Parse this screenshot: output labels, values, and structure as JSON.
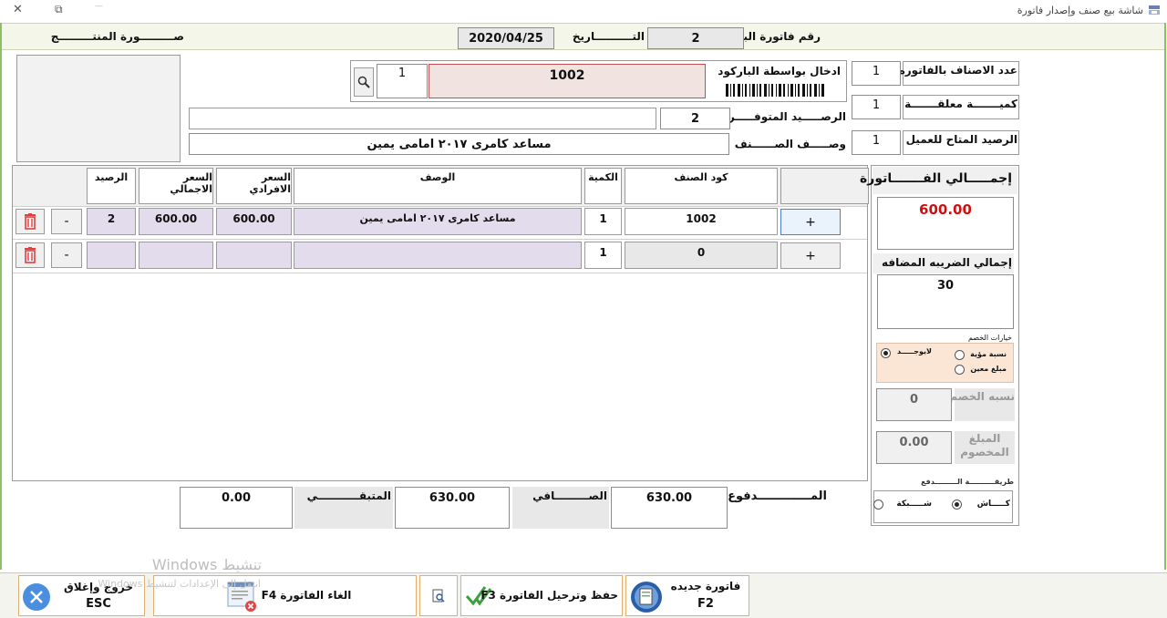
{
  "window": {
    "title": "شاشة بيع صنف وإصدار فاتورة",
    "close_glyph": "✕",
    "restore_glyph": "⧉",
    "minimize_glyph": "—"
  },
  "header": {
    "invoice_number_label": "رقم فاتورة البيع",
    "invoice_number": "2",
    "date_label": "التــــــــــاريخ",
    "date": "2020/04/25",
    "product_image_label": "صـــــــــورة المنتـــــــــج"
  },
  "entry": {
    "barcode_label": "ادخال بواسطة الباركود",
    "barcode_value": "1002",
    "quantity_value": "1",
    "available_balance_label": "الرصـــــيد المتوفـــــر",
    "available_balance": "2",
    "item_description_label": "وصـــــف الصــــــنف",
    "item_description": "مساعد كامرى ٢٠١٧ امامى يمين",
    "items_count_label": "عدد الاصناف بالفاتوره",
    "items_count": "1",
    "pending_qty_label": "كميـــــــة معلقـــــــة",
    "pending_qty": "1",
    "customer_balance_label": "الرصيد المتاح للعميل",
    "customer_balance": "1"
  },
  "grid": {
    "headers": {
      "code": "كود الصنف",
      "qty": "الكمية",
      "desc": "الوصف",
      "unit_price": "السعر الافرادي",
      "total_price": "السعر الاجمالي",
      "balance": "الرصيد"
    },
    "rows": [
      {
        "add": "+",
        "code": "1002",
        "qty": "1",
        "desc": "مساعد كامرى ٢٠١٧ امامى يمين",
        "unit_price": "600.00",
        "total_price": "600.00",
        "balance": "2",
        "remove": "-"
      },
      {
        "add": "+",
        "code": "0",
        "qty": "1",
        "desc": "",
        "unit_price": "",
        "total_price": "",
        "balance": "",
        "remove": "-"
      }
    ]
  },
  "totals": {
    "paid_label": "المـــــــــــــدفوع",
    "paid": "630.00",
    "net_label": "الصـــــــــافي",
    "net": "630.00",
    "remaining_label": "المتبقـــــــــــي",
    "remaining": "0.00"
  },
  "side": {
    "invoice_total_label": "إجمـــــالي الفـــــــاتورة",
    "invoice_total": "600.00",
    "tax_total_label": "إجمالي الضريبه المضافه",
    "tax_total": "30",
    "discount_options_label": "خيارات الخصم",
    "discount_none": "لايوجـــــد",
    "discount_percent": "نسبة مؤية",
    "discount_amount": "مبلغ معين",
    "discount_rate_label": "نسبه الخصم",
    "discount_rate": "0",
    "discount_value_label": "المبلغ المخصوم",
    "discount_value": "0.00",
    "payment_method_label": "طريقــــــــــة الـــــــــدفع",
    "payment_cash": "كـــــاش",
    "payment_network": "شـــــبكة"
  },
  "toolbar": {
    "new_invoice": "فاتورة جديده",
    "new_invoice_key": "F2",
    "save_invoice": "حفظ وترحيل الفاتورة F3",
    "cancel_invoice": "الغاء الفاتورة F4",
    "exit": "خروج وإغلاق",
    "exit_key": "ESC"
  },
  "watermark": {
    "line1": "تنشيط Windows",
    "line2": "انتقل إلى الإعدادات لتنشيط Windows."
  },
  "colors": {
    "accent_green": "#8bbf6a",
    "total_red": "#d01010",
    "lavender": "#e2dcec",
    "discount_bg": "#fbe6d6",
    "toolbar_border": "#e0b070"
  }
}
